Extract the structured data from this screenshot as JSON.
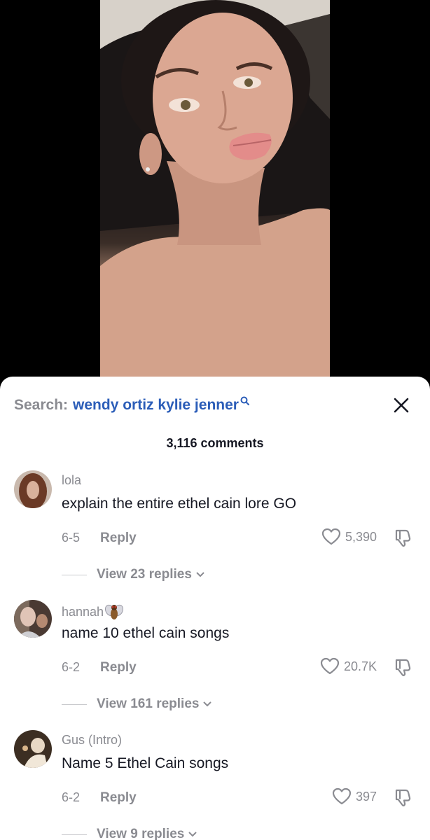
{
  "video": {
    "description_icon": "portrait-video-frame"
  },
  "search": {
    "prefix": "Search:",
    "term": "wendy ortiz kylie jenner"
  },
  "header": {
    "comment_count": "3,116 comments"
  },
  "comments": [
    {
      "username": "lola",
      "text": "explain the entire ethel cain lore GO",
      "date": "6-5",
      "reply_label": "Reply",
      "likes": "5,390",
      "view_replies": "View 23 replies"
    },
    {
      "username": "hannah",
      "badge_icon": "fly-emoji-icon",
      "text": "name 10 ethel cain songs",
      "date": "6-2",
      "reply_label": "Reply",
      "likes": "20.7K",
      "view_replies": "View 161 replies"
    },
    {
      "username": "Gus (Intro)",
      "text": "Name 5 Ethel Cain songs",
      "date": "6-2",
      "reply_label": "Reply",
      "likes": "397",
      "view_replies": "View 9 replies"
    }
  ],
  "colors": {
    "accent_link": "#2b5db8",
    "muted_text": "#8a8b91",
    "primary_text": "#161823"
  }
}
